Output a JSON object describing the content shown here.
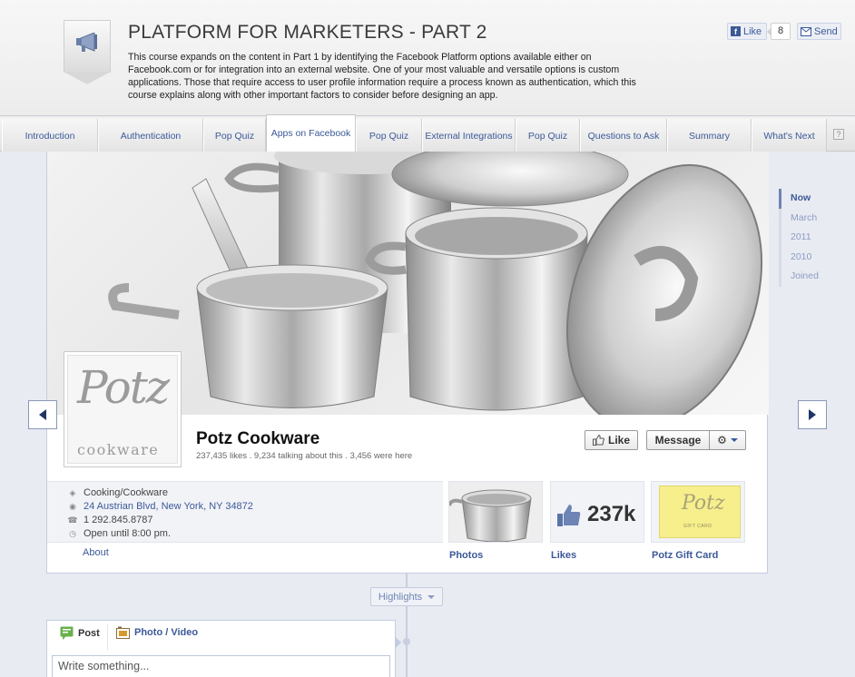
{
  "course": {
    "title": "PLATFORM FOR MARKETERS - PART 2",
    "description": "This course expands on the content in Part 1 by identifying the Facebook Platform options available either on Facebook.com or for integration into an external website. One of your most valuable and versatile options is custom applications. Those that require access to user profile information require a process known as authentication, which this course explains along with other important factors to consider before designing an app.",
    "badge_icon": "megaphone-icon",
    "like_label": "Like",
    "like_count": "8",
    "send_label": "Send"
  },
  "tabs": [
    {
      "label": "Introduction"
    },
    {
      "label": "Authentication"
    },
    {
      "label": "Pop Quiz"
    },
    {
      "label": "Apps on Facebook"
    },
    {
      "label": "Pop Quiz"
    },
    {
      "label": "External Integrations"
    },
    {
      "label": "Pop Quiz"
    },
    {
      "label": "Questions to Ask"
    },
    {
      "label": "Summary"
    },
    {
      "label": "What's Next"
    }
  ],
  "help_label": "?",
  "page": {
    "logo_text": "Potz",
    "logo_sub": "cookware",
    "name": "Potz Cookware",
    "stats": "237,435 likes . 9,234 talking about this . 3,456 were here",
    "like_button": "Like",
    "message_button": "Message",
    "info": {
      "category": "Cooking/Cookware",
      "address": "24 Austrian Blvd, New York, NY 34872",
      "phone": "1 292.845.8787",
      "hours": "Open until 8:00 pm."
    },
    "about_link": "About",
    "apps": {
      "photos_label": "Photos",
      "likes_label": "Likes",
      "likes_count": "237k",
      "gift_label": "Potz Gift Card",
      "gift_logo": "Potz",
      "gift_sub": "GIFT CARD"
    }
  },
  "scrubber": [
    {
      "label": "Now"
    },
    {
      "label": "March"
    },
    {
      "label": "2011"
    },
    {
      "label": "2010"
    },
    {
      "label": "Joined"
    }
  ],
  "highlights_label": "Highlights",
  "composer": {
    "post_label": "Post",
    "photo_label": "Photo / Video",
    "placeholder": "Write something..."
  },
  "colors": {
    "fb_blue": "#3b5998",
    "timeline_bg": "#e9ebf2",
    "gift_yellow": "#f7ef8c"
  }
}
